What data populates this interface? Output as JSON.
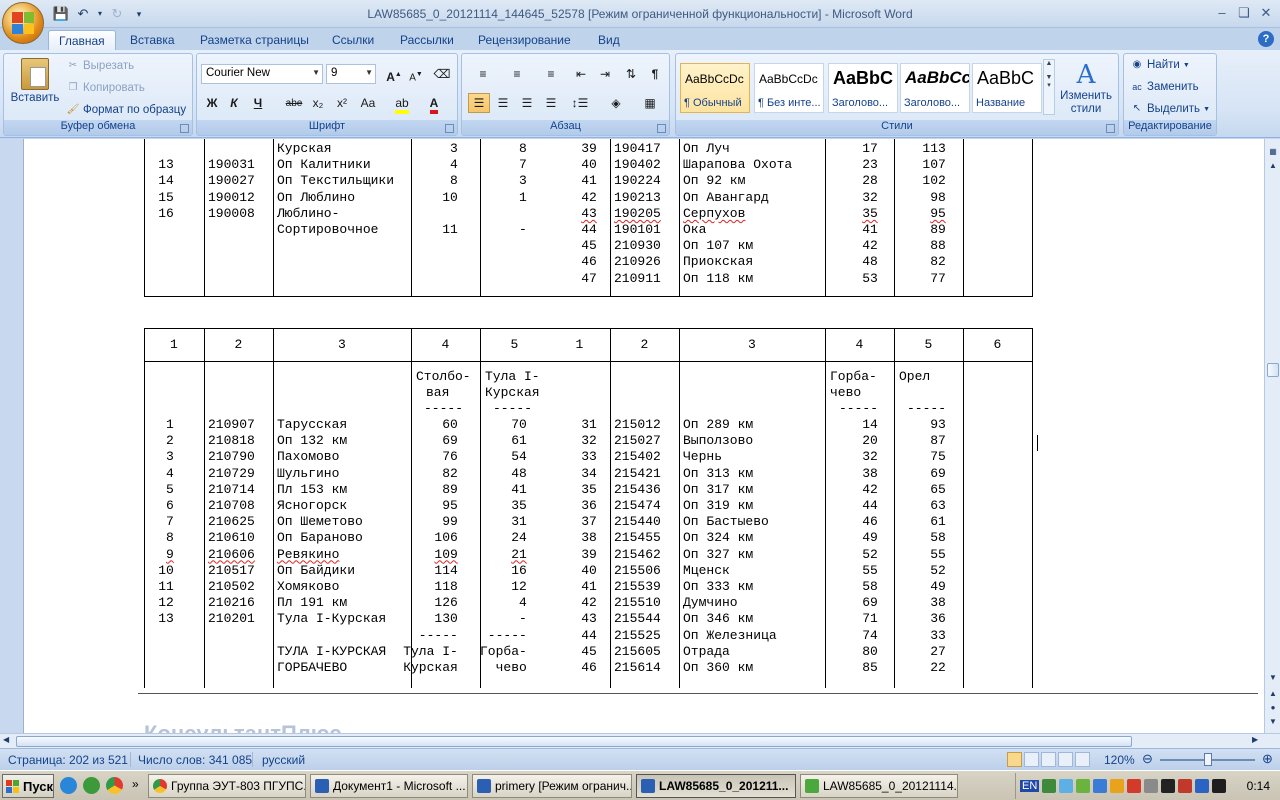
{
  "window": {
    "title": "LAW85685_0_20121114_144645_52578 [Режим ограниченной функциональности] - Microsoft Word"
  },
  "tabs": [
    "Главная",
    "Вставка",
    "Разметка страницы",
    "Ссылки",
    "Рассылки",
    "Рецензирование",
    "Вид"
  ],
  "ribbon": {
    "clipboard": {
      "paste": "Вставить",
      "cut": "Вырезать",
      "copy": "Копировать",
      "format_painter": "Формат по образцу",
      "label": "Буфер обмена"
    },
    "font": {
      "name": "Courier New",
      "size": "9",
      "label": "Шрифт",
      "bold": "Ж",
      "italic": "К",
      "underline": "Ч",
      "strike": "abe",
      "sub": "x₂",
      "sup": "x²",
      "case": "Aa",
      "grow": "A",
      "shrink": "A"
    },
    "paragraph": {
      "label": "Абзац",
      "pilcrow": "¶"
    },
    "styles": {
      "label": "Стили",
      "tiles": [
        {
          "sample": "AaBbCcDc",
          "name": "¶ Обычный"
        },
        {
          "sample": "AaBbCcDc",
          "name": "¶ Без инте..."
        },
        {
          "sample": "AaBbC",
          "name": "Заголово..."
        },
        {
          "sample": "AaBbCc",
          "name": "Заголово..."
        },
        {
          "sample": "AaBbC",
          "name": "Название"
        }
      ],
      "change_styles": "Изменить стили"
    },
    "editing": {
      "label": "Редактирование",
      "find": "Найти",
      "replace": "Заменить",
      "select": "Выделить"
    }
  },
  "doc": {
    "top_rows": [
      {
        "c1": "",
        "c2": "",
        "c3": "Курская",
        "c4": "3",
        "c5": "8",
        "c6": "39",
        "c7": "190417",
        "c8": "Оп Луч",
        "c9": "17",
        "c10": "113"
      },
      {
        "c1": "13",
        "c2": "190031",
        "c3": "Оп Калитники",
        "c4": "4",
        "c5": "7",
        "c6": "40",
        "c7": "190402",
        "c8": "Шарапова Охота",
        "c9": "23",
        "c10": "107"
      },
      {
        "c1": "14",
        "c2": "190027",
        "c3": "Оп Текстильщики",
        "c4": "8",
        "c5": "3",
        "c6": "41",
        "c7": "190224",
        "c8": "Оп 92 км",
        "c9": "28",
        "c10": "102"
      },
      {
        "c1": "15",
        "c2": "190012",
        "c3": "Оп Люблино",
        "c4": "10",
        "c5": "1",
        "c6": "42",
        "c7": "190213",
        "c8": "Оп Авангард",
        "c9": "32",
        "c10": "98"
      },
      {
        "c1": "16",
        "c2": "190008",
        "c3": "Люблино-",
        "c4": "",
        "c5": "",
        "c6": "43",
        "c7": "190205",
        "c8": "Серпухов",
        "c9": "35",
        "c10": "95"
      },
      {
        "c1": "",
        "c2": "",
        "c3": "Сортировочное",
        "c4": "11",
        "c5": "-",
        "c6": "44",
        "c7": "190101",
        "c8": "Ока",
        "c9": "41",
        "c10": "89"
      },
      {
        "c1": "",
        "c2": "",
        "c3": "",
        "c4": "",
        "c5": "",
        "c6": "45",
        "c7": "210930",
        "c8": "Оп 107 км",
        "c9": "42",
        "c10": "88"
      },
      {
        "c1": "",
        "c2": "",
        "c3": "",
        "c4": "",
        "c5": "",
        "c6": "46",
        "c7": "210926",
        "c8": "Приокская",
        "c9": "48",
        "c10": "82"
      },
      {
        "c1": "",
        "c2": "",
        "c3": "",
        "c4": "",
        "c5": "",
        "c6": "47",
        "c7": "210911",
        "c8": "Оп 118 км",
        "c9": "53",
        "c10": "77"
      }
    ],
    "header_nums": [
      "1",
      "2",
      "3",
      "4",
      "5",
      "1",
      "2",
      "3",
      "4",
      "5",
      "6"
    ],
    "subhead": {
      "c4a": "Столбо-",
      "c4b": "вая",
      "c5a": "Тула I-",
      "c5b": "Курская",
      "c9a": "Горба-",
      "c9b": "чево",
      "c10a": "Орел",
      "dash": "-----"
    },
    "rows": [
      {
        "c1": "1",
        "c2": "210907",
        "c3": "Тарусская",
        "c4": "60",
        "c5": "70",
        "c6": "31",
        "c7": "215012",
        "c8": "Оп 289 км",
        "c9": "14",
        "c10": "93"
      },
      {
        "c1": "2",
        "c2": "210818",
        "c3": "Оп 132 км",
        "c4": "69",
        "c5": "61",
        "c6": "32",
        "c7": "215027",
        "c8": "Выползово",
        "c9": "20",
        "c10": "87"
      },
      {
        "c1": "3",
        "c2": "210790",
        "c3": "Пахомово",
        "c4": "76",
        "c5": "54",
        "c6": "33",
        "c7": "215402",
        "c8": "Чернь",
        "c9": "32",
        "c10": "75"
      },
      {
        "c1": "4",
        "c2": "210729",
        "c3": "Шульгино",
        "c4": "82",
        "c5": "48",
        "c6": "34",
        "c7": "215421",
        "c8": "Оп 313 км",
        "c9": "38",
        "c10": "69"
      },
      {
        "c1": "5",
        "c2": "210714",
        "c3": "Пл 153 км",
        "c4": "89",
        "c5": "41",
        "c6": "35",
        "c7": "215436",
        "c8": "Оп 317 км",
        "c9": "42",
        "c10": "65"
      },
      {
        "c1": "6",
        "c2": "210708",
        "c3": "Ясногорск",
        "c4": "95",
        "c5": "35",
        "c6": "36",
        "c7": "215474",
        "c8": "Оп 319 км",
        "c9": "44",
        "c10": "63"
      },
      {
        "c1": "7",
        "c2": "210625",
        "c3": "Оп Шеметово",
        "c4": "99",
        "c5": "31",
        "c6": "37",
        "c7": "215440",
        "c8": "Оп Бастыево",
        "c9": "46",
        "c10": "61"
      },
      {
        "c1": "8",
        "c2": "210610",
        "c3": "Оп Бараново",
        "c4": "106",
        "c5": "24",
        "c6": "38",
        "c7": "215455",
        "c8": "Оп 324 км",
        "c9": "49",
        "c10": "58"
      },
      {
        "c1": "9",
        "c2": "210606",
        "c3": "Ревякино",
        "c4": "109",
        "c5": "21",
        "c6": "39",
        "c7": "215462",
        "c8": "Оп 327 км",
        "c9": "52",
        "c10": "55"
      },
      {
        "c1": "10",
        "c2": "210517",
        "c3": "Оп Байдики",
        "c4": "114",
        "c5": "16",
        "c6": "40",
        "c7": "215506",
        "c8": "Мценск",
        "c9": "55",
        "c10": "52"
      },
      {
        "c1": "11",
        "c2": "210502",
        "c3": "Хомяково",
        "c4": "118",
        "c5": "12",
        "c6": "41",
        "c7": "215539",
        "c8": "Оп 333 км",
        "c9": "58",
        "c10": "49"
      },
      {
        "c1": "12",
        "c2": "210216",
        "c3": "Пл 191 км",
        "c4": "126",
        "c5": "4",
        "c6": "42",
        "c7": "215510",
        "c8": "Думчино",
        "c9": "69",
        "c10": "38"
      },
      {
        "c1": "13",
        "c2": "210201",
        "c3": "Тула I-Курская",
        "c4": "130",
        "c5": "-",
        "c6": "43",
        "c7": "215544",
        "c8": "Оп 346 км",
        "c9": "71",
        "c10": "36"
      },
      {
        "c1": "",
        "c2": "",
        "c3": "",
        "c4": "-----",
        "c5": "-----",
        "c6": "44",
        "c7": "215525",
        "c8": "Оп Железница",
        "c9": "74",
        "c10": "33"
      },
      {
        "c1": "",
        "c2": "",
        "c3": "ТУЛА I-КУРСКАЯ",
        "c4": "Тула I-",
        "c5": "Горба-",
        "c6": "45",
        "c7": "215605",
        "c8": "Отрада",
        "c9": "80",
        "c10": "27"
      },
      {
        "c1": "",
        "c2": "",
        "c3": "ГОРБАЧЕВО",
        "c4": "Курская",
        "c5": "чево",
        "c6": "46",
        "c7": "215614",
        "c8": "Оп 360 км",
        "c9": "85",
        "c10": "22"
      }
    ],
    "footer_text": "КонсультантПлюс"
  },
  "status": {
    "page": "Страница: 202 из 521",
    "words": "Число слов: 341 085",
    "lang": "русский",
    "zoom": "120%"
  },
  "taskbar": {
    "start": "Пуск",
    "buttons": [
      "Группа ЭУТ-803 ПГУПС...",
      "Документ1 - Microsoft ...",
      "primery [Режим огранич...",
      "LAW85685_0_201211...",
      "LAW85685_0_20121114..."
    ],
    "tray_lang": "EN",
    "clock": "0:14"
  }
}
